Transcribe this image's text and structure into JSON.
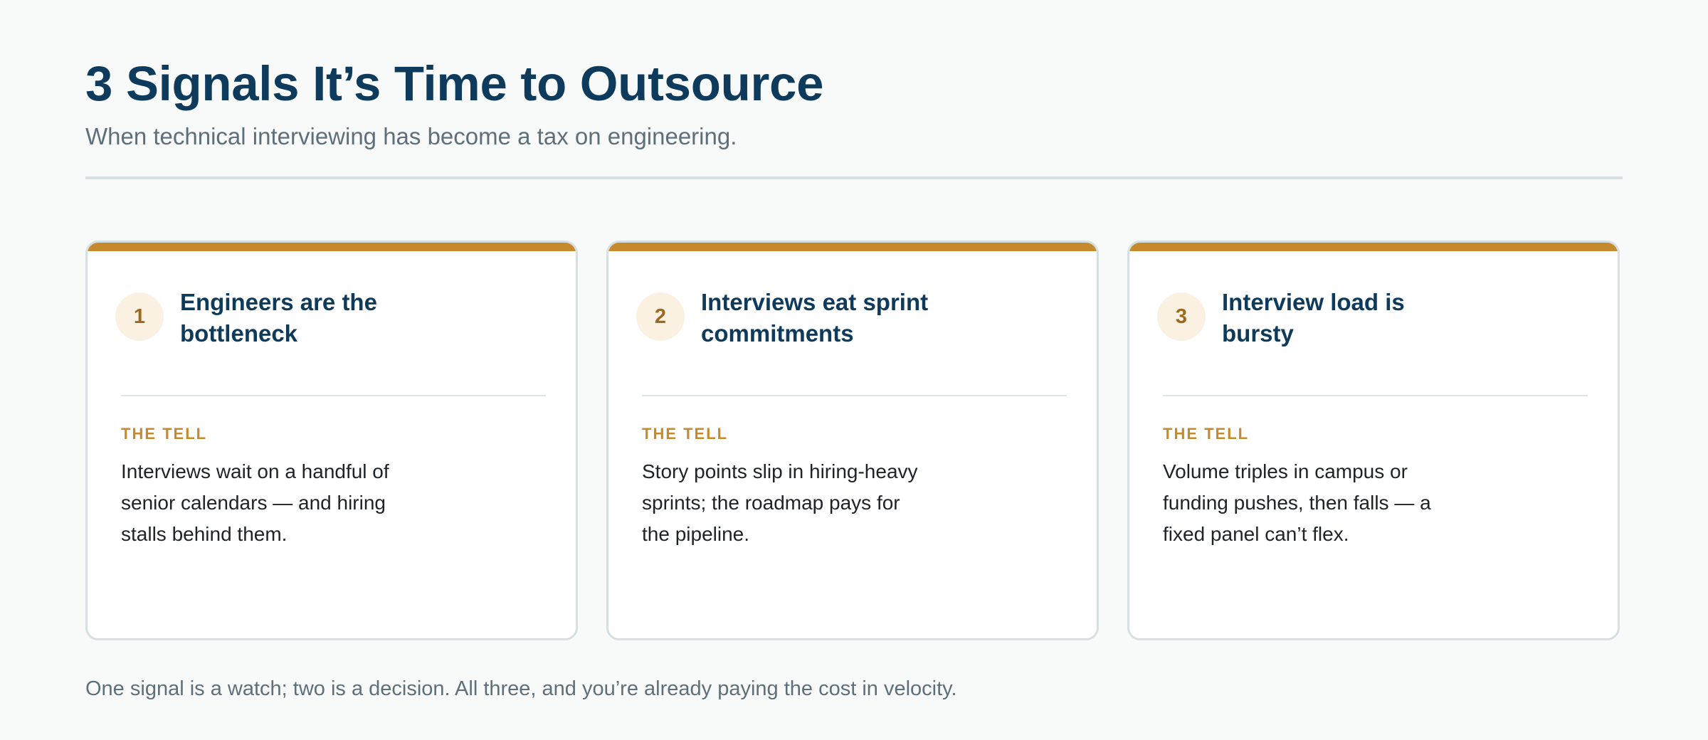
{
  "header": {
    "title": "3 Signals It’s Time to Outsource",
    "subtitle": "When technical interviewing has become a tax on engineering."
  },
  "signals": [
    {
      "number": "1",
      "title": "Engineers are the bottleneck",
      "tell_label": "THE TELL",
      "tell_text": "Interviews wait on a handful of senior calendars — and hiring stalls behind them."
    },
    {
      "number": "2",
      "title": "Interviews eat sprint commitments",
      "tell_label": "THE TELL",
      "tell_text": "Story points slip in hiring-heavy sprints; the roadmap pays for the pipeline."
    },
    {
      "number": "3",
      "title": "Interview load is bursty",
      "tell_label": "THE TELL",
      "tell_text": "Volume triples in campus or funding pushes, then falls — a fixed panel can’t flex."
    }
  ],
  "footer": {
    "text": "One signal is a watch; two is a decision. All three, and you’re already paying the cost in velocity."
  },
  "colors": {
    "title": "#0e3a5c",
    "accent": "#c68a2e",
    "muted_text": "#5f6f7a",
    "background": "#f8fafa",
    "card_border": "#d6e0e2"
  }
}
